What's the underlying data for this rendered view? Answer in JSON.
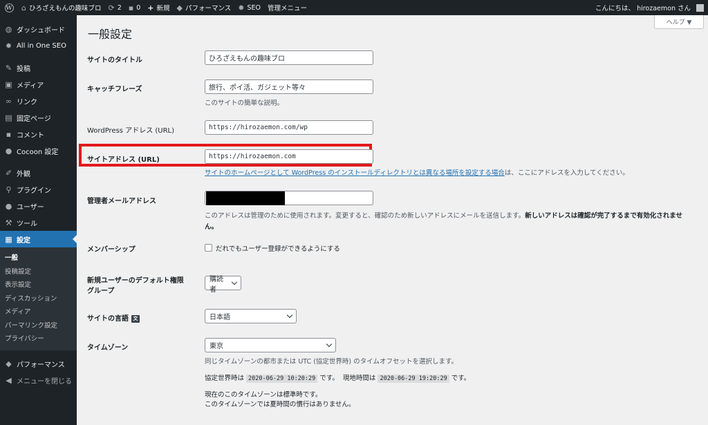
{
  "adminbar": {
    "site_name": "ひろざえもんの趣味ブロ",
    "updates_count": "2",
    "comments_count": "0",
    "new_label": "新規",
    "performance_label": "パフォーマンス",
    "seo_label": "SEO",
    "admin_menu_label": "管理メニュー",
    "greeting": "こんにちは、 hirozaemon さん"
  },
  "sidebar": {
    "items": [
      {
        "label": "ダッシュボード",
        "icon": "dashboard-icon"
      },
      {
        "label": "All in One SEO",
        "icon": "gear-icon"
      },
      {
        "label": "投稿",
        "icon": "pin-icon"
      },
      {
        "label": "メディア",
        "icon": "media-icon"
      },
      {
        "label": "リンク",
        "icon": "link-icon"
      },
      {
        "label": "固定ページ",
        "icon": "page-icon"
      },
      {
        "label": "コメント",
        "icon": "comment-icon"
      },
      {
        "label": "Cocoon 設定",
        "icon": "cocoon-icon"
      },
      {
        "label": "外観",
        "icon": "brush-icon"
      },
      {
        "label": "プラグイン",
        "icon": "plugin-icon"
      },
      {
        "label": "ユーザー",
        "icon": "user-icon"
      },
      {
        "label": "ツール",
        "icon": "wrench-icon"
      },
      {
        "label": "設定",
        "icon": "settings-icon"
      }
    ],
    "submenu": [
      "一般",
      "投稿設定",
      "表示設定",
      "ディスカッション",
      "メディア",
      "パーマリンク設定",
      "プライバシー"
    ],
    "performance": "パフォーマンス",
    "collapse": "メニューを閉じる"
  },
  "main": {
    "title": "一般設定",
    "help": "ヘルプ ▼",
    "fields": {
      "site_title": {
        "label": "サイトのタイトル",
        "value": "ひろざえもんの趣味ブロ"
      },
      "tagline": {
        "label": "キャッチフレーズ",
        "value": "旅行、ポイ活、ガジェット等々",
        "desc": "このサイトの簡単な説明。"
      },
      "wp_address": {
        "label": "WordPress アドレス (URL)",
        "value": "https://hirozaemon.com/wp"
      },
      "site_address": {
        "label": "サイトアドレス (URL)",
        "value": "https://hirozaemon.com",
        "desc_link": "サイトのホームページとして WordPress のインストールディレクトリとは異なる場所を設定する場合",
        "desc_rest": "は、ここにアドレスを入力してください。"
      },
      "admin_email": {
        "label": "管理者メールアドレス",
        "desc_1": "このアドレスは管理のために使用されます。変更すると、確認のため新しいアドレスにメールを送信します。",
        "desc_bold": "新しいアドレスは確認が完了するまで有効化されませ",
        "desc_2": "ん。"
      },
      "membership": {
        "label": "メンバーシップ",
        "checkbox_label": "だれでもユーザー登録ができるようにする"
      },
      "default_role": {
        "label_1": "新規ユーザーのデフォルト権限",
        "label_2": "グループ",
        "value": "購読者"
      },
      "site_language": {
        "label": "サイトの言語",
        "value": "日本語"
      },
      "timezone": {
        "label": "タイムゾーン",
        "value": "東京",
        "desc": "同じタイムゾーンの都市または UTC (協定世界時) のタイムオフセットを選択します。",
        "utc_prefix": "協定世界時は",
        "utc_time": "2020-06-29 10:20:29",
        "utc_suffix": "です。",
        "local_prefix": "現地時間は",
        "local_time": "2020-06-29 19:20:29",
        "local_suffix": "です。",
        "std_note": "現在のこのタイムゾーンは標準時です。",
        "dst_note": "このタイムゾーンでは夏時間の慣行はありません。"
      }
    }
  }
}
